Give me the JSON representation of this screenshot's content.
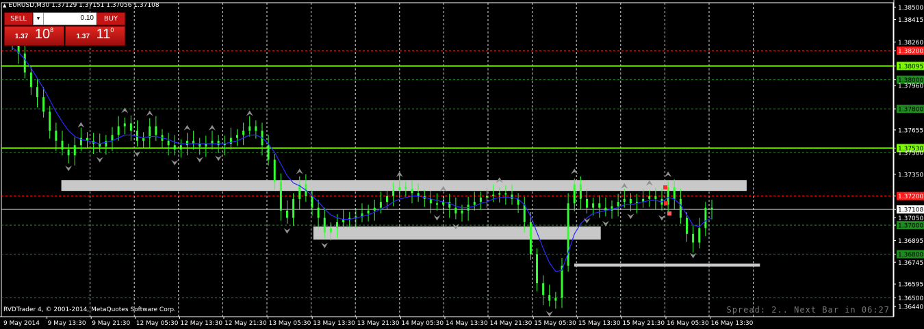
{
  "header": {
    "symbol_info": "EURUSD,M30  1.37129 1.37151 1.37056 1.37108"
  },
  "trade_panel": {
    "sell_label": "SELL",
    "buy_label": "BUY",
    "lot_value": "0.10",
    "sell_price": {
      "small": "1.37",
      "big": "10",
      "sup": "8"
    },
    "buy_price": {
      "small": "1.37",
      "big": "11",
      "sup": "0"
    }
  },
  "footer": {
    "copyright": "RVDTrader 4, © 2001-2014, MetaQuotes Software Corp.",
    "spread_text": "Spread: 2.. Next Bar in 06:27"
  },
  "colors": {
    "background": "#000000",
    "grid": "#ffffff",
    "candle": "#32ff32",
    "ma": "#2b2bff",
    "support_zone": "#c8c8c8",
    "green_level": "#7cfc00",
    "red_level": "#ff2a2a",
    "fractal": "#8f8f8f"
  },
  "chart_data": {
    "type": "candlestick",
    "symbol": "EURUSD",
    "timeframe": "M30",
    "ohlc_current": {
      "open": 1.37129,
      "high": 1.37151,
      "low": 1.37056,
      "close": 1.37108
    },
    "ylim": [
      1.3637,
      1.3853
    ],
    "y_ticks": [
      {
        "value": 1.385,
        "label": "1.38500",
        "style": "plain"
      },
      {
        "value": 1.38415,
        "label": "1.38415",
        "style": "plain"
      },
      {
        "value": 1.3826,
        "label": "1.38260",
        "style": "plain"
      },
      {
        "value": 1.382,
        "label": "1.38200",
        "style": "red"
      },
      {
        "value": 1.38095,
        "label": "1.38095",
        "style": "lime"
      },
      {
        "value": 1.38,
        "label": "1.38000",
        "style": "green"
      },
      {
        "value": 1.3796,
        "label": "1.37960",
        "style": "plain"
      },
      {
        "value": 1.378,
        "label": "1.37800",
        "style": "green"
      },
      {
        "value": 1.37655,
        "label": "1.37655",
        "style": "plain"
      },
      {
        "value": 1.3753,
        "label": "1.37530",
        "style": "lime"
      },
      {
        "value": 1.375,
        "label": "1.37500",
        "style": "plain"
      },
      {
        "value": 1.3735,
        "label": "1.37350",
        "style": "plain"
      },
      {
        "value": 1.372,
        "label": "1.37200",
        "style": "red"
      },
      {
        "value": 1.37108,
        "label": "1.37108",
        "style": "current"
      },
      {
        "value": 1.3705,
        "label": "1.37050",
        "style": "plain"
      },
      {
        "value": 1.37,
        "label": "1.37000",
        "style": "green"
      },
      {
        "value": 1.36895,
        "label": "1.36895",
        "style": "plain"
      },
      {
        "value": 1.368,
        "label": "1.36800",
        "style": "green"
      },
      {
        "value": 1.36745,
        "label": "1.36745",
        "style": "plain"
      },
      {
        "value": 1.36595,
        "label": "1.36595",
        "style": "plain"
      },
      {
        "value": 1.365,
        "label": "1.36500",
        "style": "plain"
      },
      {
        "value": 1.3644,
        "label": "1.36440",
        "style": "plain"
      }
    ],
    "x_labels": [
      "9 May 2014",
      "9 May 13:30",
      "9 May 21:30",
      "12 May 05:30",
      "12 May 13:30",
      "12 May 21:30",
      "13 May 05:30",
      "13 May 13:30",
      "13 May 21:30",
      "14 May 05:30",
      "14 May 13:30",
      "14 May 21:30",
      "15 May 05:30",
      "15 May 13:30",
      "15 May 21:30",
      "16 May 05:30",
      "16 May 13:30"
    ],
    "horizontal_lines": [
      {
        "value": 1.38095,
        "color": "lime"
      },
      {
        "value": 1.3753,
        "color": "lime"
      },
      {
        "value": 1.382,
        "color": "red"
      },
      {
        "value": 1.372,
        "color": "red"
      },
      {
        "value": 1.38,
        "color": "green"
      },
      {
        "value": 1.378,
        "color": "green"
      },
      {
        "value": 1.375,
        "color": "green"
      },
      {
        "value": 1.37,
        "color": "green"
      },
      {
        "value": 1.368,
        "color": "green"
      },
      {
        "value": 1.365,
        "color": "green"
      },
      {
        "value": 1.37108,
        "color": "white"
      }
    ],
    "zones": [
      {
        "from_label": 1,
        "to_label": 16.5,
        "y_top": 1.3731,
        "y_bottom": 1.37235
      },
      {
        "from_label": 6.7,
        "to_label": 13.2,
        "y_top": 1.3699,
        "y_bottom": 1.369
      },
      {
        "from_label": 12.6,
        "to_label": 16.8,
        "y_top": 1.36735,
        "y_bottom": 1.36715
      }
    ],
    "series": [
      {
        "name": "price",
        "values": [
          1.3826,
          1.3818,
          1.3805,
          1.3795,
          1.3788,
          1.3778,
          1.3765,
          1.3758,
          1.3752,
          1.3748,
          1.3755,
          1.376,
          1.3758,
          1.3756,
          1.3754,
          1.3758,
          1.3762,
          1.3768,
          1.377,
          1.3765,
          1.3758,
          1.376,
          1.3768,
          1.3762,
          1.3758,
          1.3755,
          1.3752,
          1.3755,
          1.3758,
          1.3756,
          1.3754,
          1.3756,
          1.3758,
          1.3755,
          1.3756,
          1.376,
          1.3762,
          1.3765,
          1.3768,
          1.3765,
          1.3755,
          1.3745,
          1.373,
          1.371,
          1.3705,
          1.3718,
          1.3728,
          1.372,
          1.3712,
          1.3705,
          1.3695,
          1.3698,
          1.3702,
          1.3704,
          1.3705,
          1.3706,
          1.3708,
          1.371,
          1.3712,
          1.3716,
          1.372,
          1.3724,
          1.3726,
          1.3725,
          1.3722,
          1.372,
          1.3718,
          1.3715,
          1.3714,
          1.3716,
          1.3712,
          1.3708,
          1.371,
          1.3714,
          1.3716,
          1.3719,
          1.372,
          1.3721,
          1.3722,
          1.3721,
          1.3718,
          1.3714,
          1.3702,
          1.368,
          1.366,
          1.3652,
          1.3648,
          1.365,
          1.3672,
          1.3715,
          1.3728,
          1.3718,
          1.3712,
          1.3715,
          1.3712,
          1.371,
          1.3713,
          1.3716,
          1.3718,
          1.3715,
          1.3716,
          1.3718,
          1.372,
          1.3718,
          1.3714,
          1.3726,
          1.3718,
          1.3705,
          1.3694,
          1.3688,
          1.3698,
          1.3712,
          1.3711
        ]
      },
      {
        "name": "ma",
        "values": [
          1.3822,
          1.3819,
          1.3814,
          1.3808,
          1.3801,
          1.3794,
          1.3786,
          1.3778,
          1.3771,
          1.3765,
          1.3761,
          1.3759,
          1.3758,
          1.3757,
          1.3756,
          1.3757,
          1.3758,
          1.376,
          1.3762,
          1.3762,
          1.3761,
          1.376,
          1.3761,
          1.3761,
          1.376,
          1.3759,
          1.3757,
          1.3756,
          1.3756,
          1.3756,
          1.3756,
          1.3756,
          1.3756,
          1.3756,
          1.3756,
          1.3757,
          1.3758,
          1.376,
          1.3762,
          1.3762,
          1.376,
          1.3756,
          1.375,
          1.3742,
          1.3734,
          1.3729,
          1.3727,
          1.3724,
          1.372,
          1.3716,
          1.3711,
          1.3707,
          1.3705,
          1.3704,
          1.3704,
          1.3705,
          1.3706,
          1.3707,
          1.3709,
          1.3711,
          1.3713,
          1.3716,
          1.3718,
          1.3719,
          1.372,
          1.372,
          1.3719,
          1.3718,
          1.3717,
          1.3716,
          1.3715,
          1.3713,
          1.3712,
          1.3712,
          1.3713,
          1.3715,
          1.3716,
          1.3718,
          1.3719,
          1.3719,
          1.3719,
          1.3718,
          1.3714,
          1.3706,
          1.3695,
          1.3684,
          1.3674,
          1.3668,
          1.3669,
          1.3681,
          1.3694,
          1.3701,
          1.3705,
          1.3708,
          1.3709,
          1.371,
          1.3711,
          1.3712,
          1.3714,
          1.3714,
          1.3715,
          1.3716,
          1.3717,
          1.3717,
          1.3716,
          1.3719,
          1.3718,
          1.3714,
          1.3707,
          1.37,
          1.3699,
          1.3703,
          1.3705
        ]
      }
    ]
  }
}
